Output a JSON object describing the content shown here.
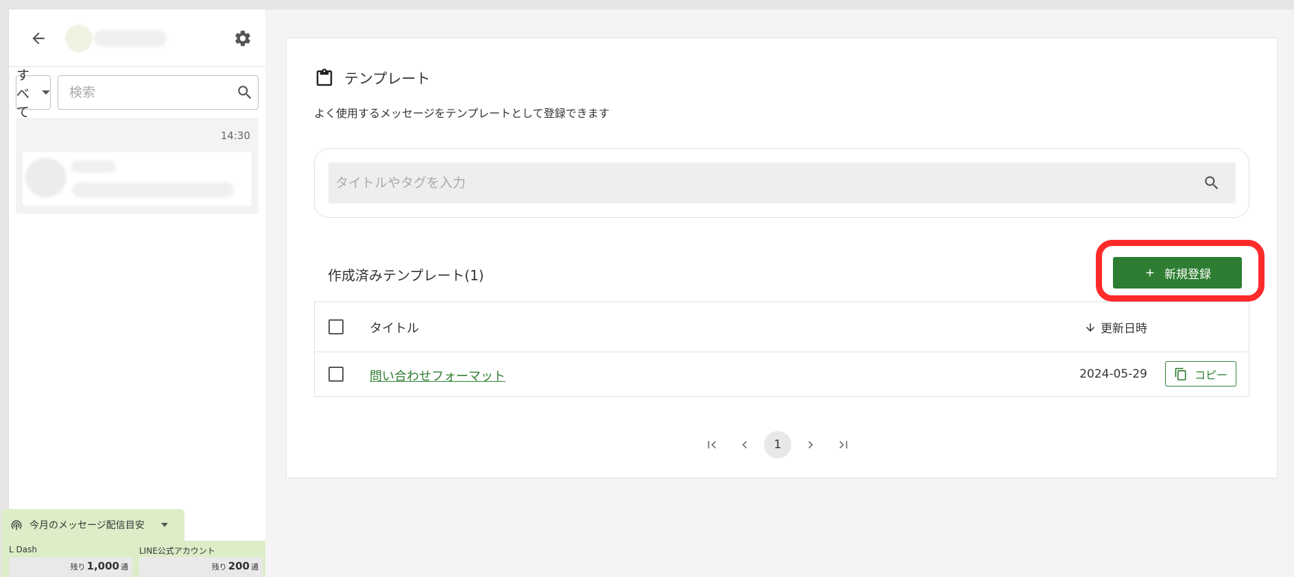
{
  "sidebar": {
    "filter": {
      "selected": "すべて"
    },
    "search": {
      "placeholder": "検索"
    },
    "conversation": {
      "time": "14:30"
    },
    "quota": {
      "label": "今月のメッセージ配信目安",
      "ldash": {
        "name": "L Dash",
        "prefix": "残り",
        "count": "1,000",
        "unit": "通"
      },
      "line_official": {
        "name": "LINE公式アカウント",
        "prefix": "残り",
        "count": "200",
        "unit": "通"
      }
    }
  },
  "main": {
    "title": "テンプレート",
    "description": "よく使用するメッセージをテンプレートとして登録できます",
    "search": {
      "placeholder": "タイトルやタグを入力"
    },
    "list_title": "作成済みテンプレート(1)",
    "new_button_label": "新規登録",
    "table": {
      "col_title": "タイトル",
      "col_updated": "更新日時",
      "rows": [
        {
          "title": "問い合わせフォーマット",
          "updated": "2024-05-29",
          "copy_label": "コピー"
        }
      ]
    },
    "pagination": {
      "current_page": "1"
    }
  },
  "colors": {
    "accent": "#2e7d32",
    "highlight": "#ff2b2b",
    "quota_bg": "#dcedc8"
  },
  "icons": [
    "arrow-left-icon",
    "gear-icon",
    "search-icon",
    "clipboard-icon",
    "plus-icon",
    "arrow-down-icon",
    "copy-icon",
    "first-page-icon",
    "prev-page-icon",
    "next-page-icon",
    "last-page-icon",
    "broadcast-icon"
  ]
}
